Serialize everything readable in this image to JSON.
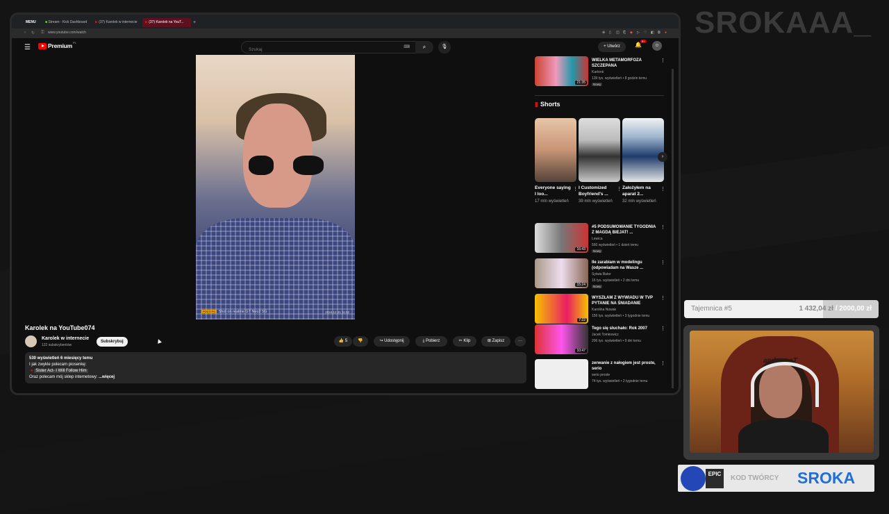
{
  "browser": {
    "tabs": [
      {
        "label": "MENU"
      },
      {
        "label": "Stream - Kick Dashboard"
      },
      {
        "label": "(37) Karolek w internecie"
      },
      {
        "label": "(37) Karolek na YouT..."
      }
    ],
    "new_tab": "+",
    "url": "www.youtube.com/watch"
  },
  "yt": {
    "brand": "Premium",
    "brand_suffix": "PL",
    "search_placeholder": "Szukaj",
    "create_label": "Utwórz",
    "notif_count": "9+"
  },
  "video": {
    "watermark_tag": "POCO F6",
    "watermark": "Shot on realme GT Neo2 5G",
    "watermark_date": "2024.12.31 11:02",
    "title": "Karolek na YouTube074",
    "channel": "Karolek w internecie",
    "subscribers": "122 subskrybentów",
    "subscribe_label": "Subskrybuj",
    "likes": "5",
    "share_label": "Udostępnij",
    "download_label": "Pobierz",
    "clip_label": "Klip",
    "save_label": "Zapisz",
    "more_label": "···"
  },
  "description": {
    "stats": "530 wyświetleń  6 miesięcy temu",
    "line1": "I jak zwykle polecam piosenkę:",
    "line2": "Sister Act- I Will Follow Him",
    "line3": "Oraz polecam mój sklep internetowy:",
    "more": "...więcej"
  },
  "sidebar": {
    "top_video": {
      "title": "WIELKA METAMORFOZA SZCZEPANA",
      "channel": "Kartonii",
      "meta": "139 tys. wyświetleń • 8 godzin temu",
      "badge": "Nowy",
      "duration": "21:35"
    },
    "shorts_heading": "Shorts",
    "shorts": [
      {
        "title": "Everyone saying I loo...",
        "views": "17 mln wyświetleń"
      },
      {
        "title": "I Customized Boyfriend's ...",
        "views": "39 mln wyświetleń"
      },
      {
        "title": "Założyłem na aparat 2...",
        "views": "32 mln wyświetleń"
      }
    ],
    "videos": [
      {
        "title": "#5 PODSUMOWANIE TYGODNIA Z MAGDĄ BIEJAT! ...",
        "channel": "Lewica",
        "meta": "560 wyświetleń • 1 dzień temu",
        "badge": "Nowy",
        "duration": "16:43"
      },
      {
        "title": "Ile zarabiam w modelingu (odpowiadam na Wasze ...",
        "channel": "Sylwia Bator",
        "meta": "16 tys. wyświetleń • 2 dni temu",
        "badge": "Nowy",
        "duration": "15:24"
      },
      {
        "title": "WYSZŁAM Z WYWIADU W TVP PYTANIE NA ŚNIADANIE",
        "channel": "Karolina Nowak",
        "meta": "156 tys. wyświetleń • 3 tygodnie temu",
        "badge": "",
        "duration": "7:22"
      },
      {
        "title": "Tego się słuchało: Rok 2007",
        "channel": "Jacek Tomkowicz",
        "meta": "206 tys. wyświetleń • 9 dni temu",
        "badge": "",
        "duration": "10:47"
      },
      {
        "title": "zerwanie z nałogiem jest proste, serio",
        "channel": "serio proste",
        "meta": "74 tys. wyświetleń • 2 tygodnie temu",
        "badge": "",
        "duration": ""
      }
    ]
  },
  "overlay": {
    "logo": "SROKAAA_",
    "goal_label": "Tajemnica #5",
    "goal_current": "1 432,04 zł",
    "goal_total": "/ 2000,00 zł",
    "goal_progress": 0.716,
    "chair_text": "anda seaT",
    "code_label": "KOD TWÓRCY",
    "code_value": "SROKA",
    "epic_logo": "EPIC"
  },
  "colors": {
    "yt_red": "#ff0000",
    "code_blue": "#1e6fd9",
    "active_tab": "#5c1020"
  }
}
